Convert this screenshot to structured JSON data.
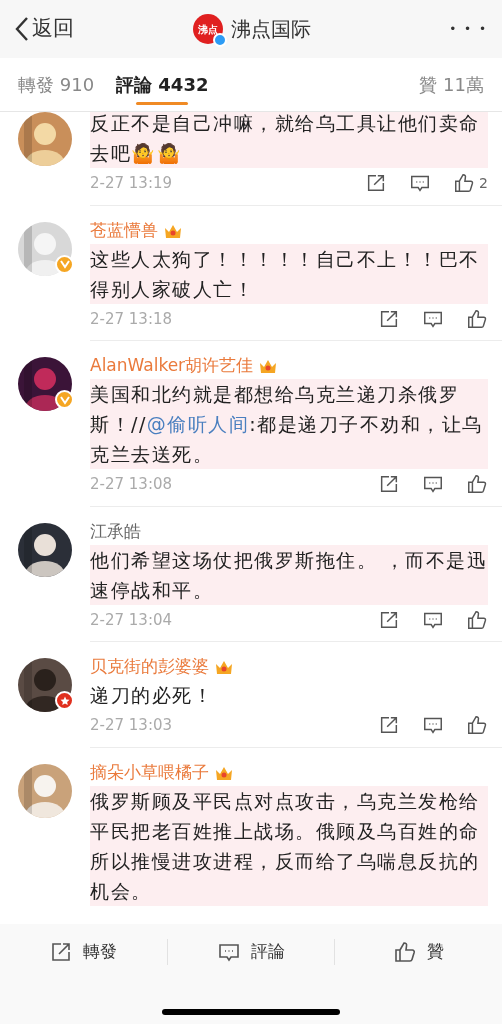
{
  "header": {
    "back_label": "返回",
    "account_name": "沸点国际",
    "account_logo_text": "沸点",
    "verified": true,
    "more": "• • •"
  },
  "tabs": [
    {
      "label": "轉發 910",
      "selected": false
    },
    {
      "label": "評論 4432",
      "selected": true
    },
    {
      "label": "贊 11萬",
      "selected": false
    }
  ],
  "comments": [
    {
      "highlighted": true,
      "text": [
        {
          "kind": "plain",
          "text": "反正不是自己冲嘛，就给乌工具让他们卖命去吧🤷🤷"
        }
      ],
      "time": "2-27 13:19",
      "likes": "2"
    },
    {
      "name": "苍蓝懵兽",
      "vip": true,
      "verified": true,
      "star": false,
      "highlighted": true,
      "text": [
        {
          "kind": "plain",
          "text": "这些人太狗了！！！！！自己不上！！巴不得别人家破人亡！"
        }
      ],
      "time": "2-27 13:18"
    },
    {
      "name": "AlanWalker胡许艺佳",
      "vip": true,
      "verified": true,
      "star": false,
      "highlighted": true,
      "text": [
        {
          "kind": "plain",
          "text": "美国和北约就是都想给乌克兰递刀杀俄罗斯！//"
        },
        {
          "kind": "mention",
          "text": "@偷听人间"
        },
        {
          "kind": "plain",
          "text": ":都是递刀子不劝和，让乌克兰去送死。"
        }
      ],
      "time": "2-27 13:08"
    },
    {
      "name": "江承皓",
      "vip": false,
      "verified": false,
      "star": false,
      "highlighted": true,
      "text": [
        {
          "kind": "plain",
          "text": "他们希望这场仗把俄罗斯拖住。 ，而不是迅速停战和平。"
        }
      ],
      "time": "2-27 13:04"
    },
    {
      "name": "贝克街的彭婆婆",
      "vip": true,
      "verified": false,
      "star": true,
      "highlighted": false,
      "text": [
        {
          "kind": "plain",
          "text": "递刀的必死！"
        }
      ],
      "time": "2-27 13:03"
    },
    {
      "name": "摘朵小草喂橘子",
      "vip": true,
      "verified": false,
      "star": false,
      "highlighted": true,
      "text": [
        {
          "kind": "plain",
          "text": "俄罗斯顾及平民点对点攻击，乌克兰发枪给平民把老百姓推上战场。俄顾及乌百姓的命所以推慢进攻进程，反而给了乌喘息反抗的机会。"
        }
      ]
    }
  ],
  "bottom_bar": [
    {
      "kind": "repost",
      "label": "轉發"
    },
    {
      "kind": "comment",
      "label": "評論"
    },
    {
      "kind": "like",
      "label": "贊"
    }
  ]
}
